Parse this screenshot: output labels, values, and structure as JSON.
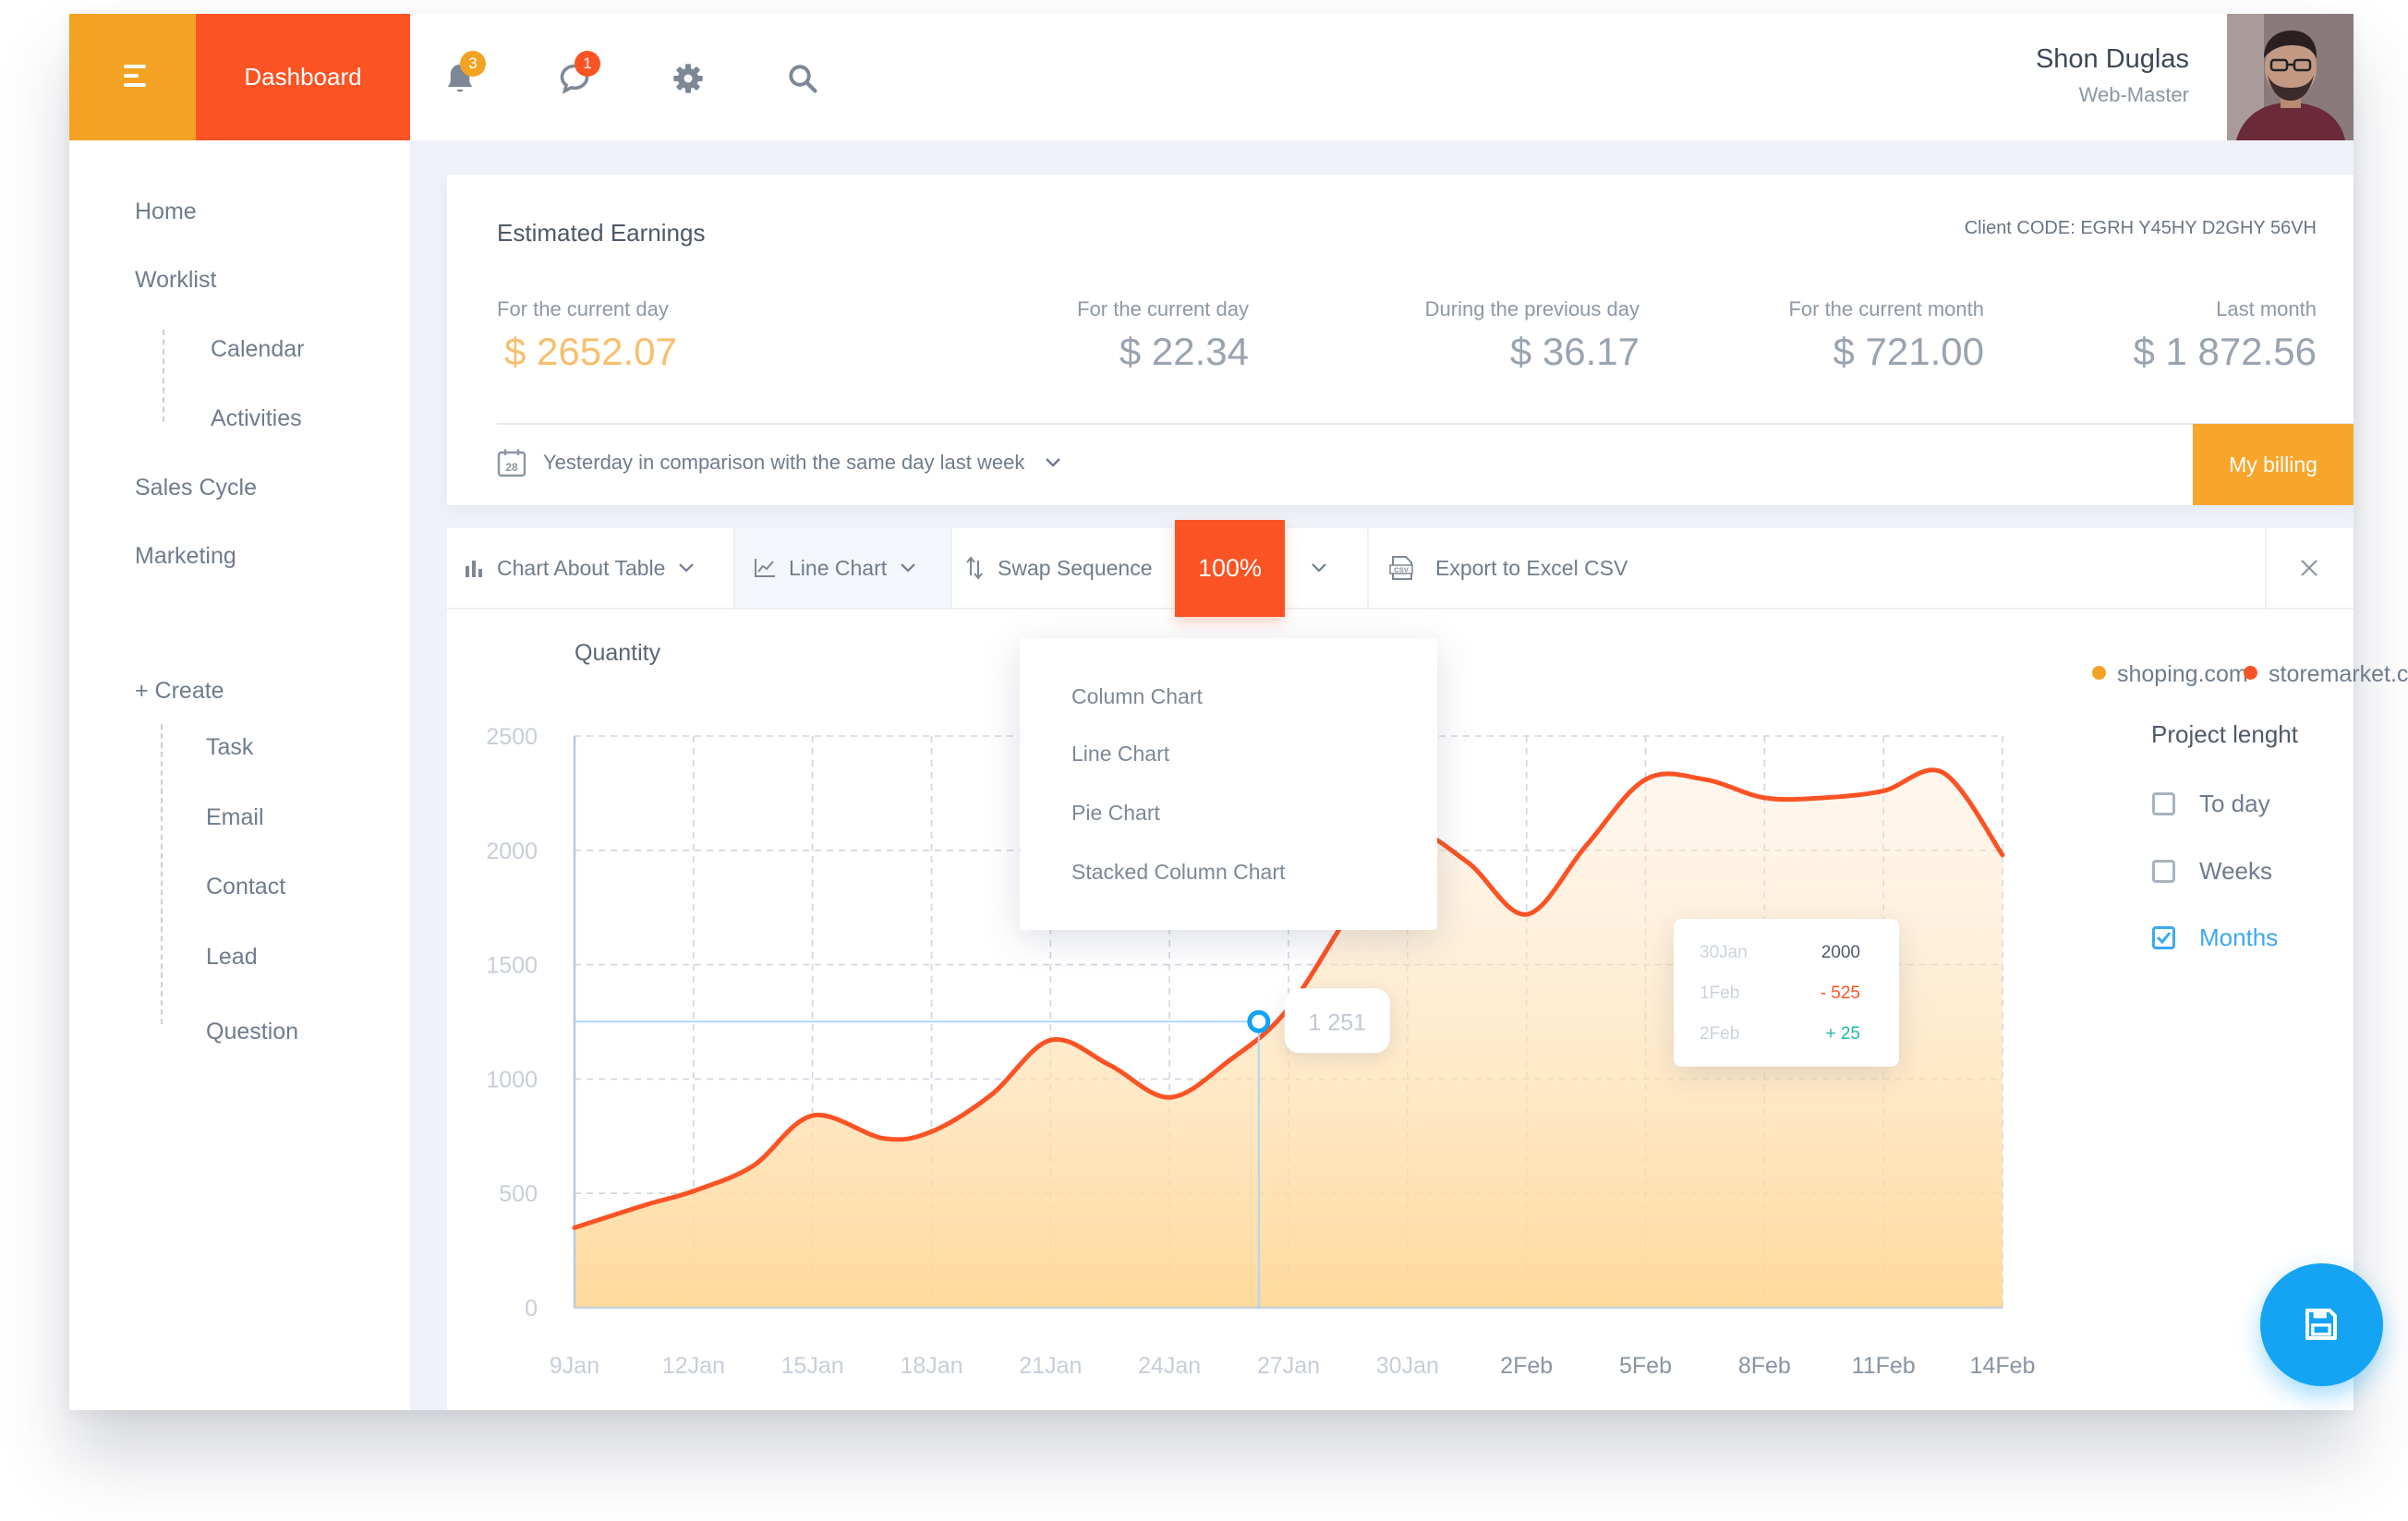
{
  "header": {
    "dashboard_label": "Dashboard",
    "notifications_count": "3",
    "messages_count": "1",
    "user_name": "Shon Duglas",
    "user_role": "Web-Master"
  },
  "sidebar": {
    "items": [
      "Home",
      "Worklist",
      "Calendar",
      "Activities",
      "Sales Cycle",
      "Marketing"
    ],
    "create_label": "+ Create",
    "create_items": [
      "Task",
      "Email",
      "Contact",
      "Lead",
      "Question"
    ]
  },
  "earnings": {
    "title": "Estimated Earnings",
    "client_code": "Client  CODE:  EGRH  Y45HY  D2GHY  56VH",
    "stats": [
      {
        "label": "For the current day",
        "value": "$ 2652.07"
      },
      {
        "label": "For the current day",
        "value": "$ 22.34"
      },
      {
        "label": "During the previous day",
        "value": "$ 36.17"
      },
      {
        "label": "For the current month",
        "value": "$ 721.00"
      },
      {
        "label": "Last month",
        "value": "$ 1 872.56"
      }
    ],
    "calendar_day": "28",
    "compare_text": "Yesterday in comparison with the same day last week",
    "billing_label": "My billing"
  },
  "toolbar": {
    "chart_about_table": "Chart About Table",
    "line_chart": "Line Chart",
    "swap_sequence": "Swap Sequence",
    "percent": "100%",
    "export_label": "Export to Excel CSV",
    "csv_icon_text": "CSV"
  },
  "dropdown": {
    "items": [
      "Column Chart",
      "Line Chart",
      "Pie  Chart",
      "Stacked  Column    Chart"
    ]
  },
  "legend": {
    "shop": "shoping.com",
    "store": "storemarket.com"
  },
  "project_length": {
    "title": "Project lenght",
    "options": [
      {
        "label": "To day",
        "checked": false
      },
      {
        "label": "Weeks",
        "checked": false
      },
      {
        "label": "Months",
        "checked": true
      }
    ]
  },
  "tooltip": {
    "point_value": "1 251",
    "rows": [
      {
        "date": "30Jan",
        "value": "2000"
      },
      {
        "date": "1Feb",
        "value": "- 525"
      },
      {
        "date": "2Feb",
        "value": "+ 25"
      }
    ]
  },
  "colors": {
    "orange": "#f4a224",
    "red": "#fb5324",
    "blue": "#14a4f3",
    "green": "#21b8a5"
  },
  "chart_data": {
    "type": "area",
    "ylabel": "Quantity",
    "ylim": [
      0,
      2500
    ],
    "y_ticks": [
      "0",
      "500",
      "1000",
      "1500",
      "2000",
      "2500"
    ],
    "categories": [
      "9Jan",
      "12Jan",
      "15Jan",
      "18Jan",
      "21Jan",
      "24Jan",
      "27Jan",
      "30Jan",
      "2Feb",
      "5Feb",
      "8Feb",
      "11Feb",
      "14Feb"
    ],
    "grid": true,
    "legend_position": "top-right",
    "series": [
      {
        "name": "storemarket.com",
        "x": [
          0,
          0.6,
          1.0,
          1.5,
          2.0,
          2.6,
          3.0,
          3.5,
          4.0,
          4.5,
          5.0,
          5.5,
          6.0,
          6.6,
          7.0,
          7.5,
          8.0,
          8.5,
          9.0,
          9.5,
          10.0,
          10.5,
          11.0,
          11.5,
          12.0
        ],
        "values": [
          350,
          450,
          510,
          620,
          840,
          740,
          770,
          930,
          1170,
          1060,
          920,
          1080,
          1310,
          1800,
          2080,
          1950,
          1720,
          2020,
          2310,
          2310,
          2230,
          2230,
          2260,
          2340,
          1980
        ]
      }
    ]
  }
}
